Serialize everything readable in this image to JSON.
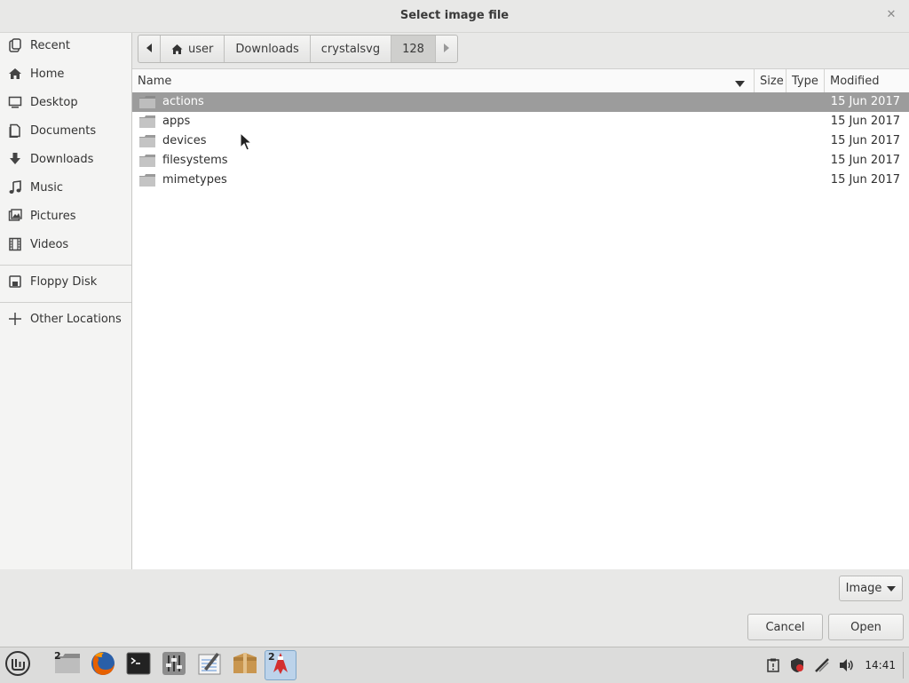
{
  "window": {
    "title": "Select image file"
  },
  "sidebar": {
    "items": [
      {
        "label": "Recent",
        "icon": "recent-icon"
      },
      {
        "label": "Home",
        "icon": "home-icon"
      },
      {
        "label": "Desktop",
        "icon": "desktop-icon"
      },
      {
        "label": "Documents",
        "icon": "documents-icon"
      },
      {
        "label": "Downloads",
        "icon": "downloads-icon"
      },
      {
        "label": "Music",
        "icon": "music-icon"
      },
      {
        "label": "Pictures",
        "icon": "pictures-icon"
      },
      {
        "label": "Videos",
        "icon": "videos-icon"
      },
      {
        "label": "Floppy Disk",
        "icon": "floppy-icon"
      },
      {
        "label": "Other Locations",
        "icon": "plus-icon"
      }
    ]
  },
  "pathbar": {
    "crumbs": [
      "user",
      "Downloads",
      "crystalsvg",
      "128"
    ],
    "active": "128"
  },
  "columns": {
    "name": "Name",
    "size": "Size",
    "type": "Type",
    "modified": "Modified"
  },
  "files": [
    {
      "name": "actions",
      "modified": "15 Jun 2017",
      "selected": true
    },
    {
      "name": "apps",
      "modified": "15 Jun 2017"
    },
    {
      "name": "devices",
      "modified": "15 Jun 2017"
    },
    {
      "name": "filesystems",
      "modified": "15 Jun 2017"
    },
    {
      "name": "mimetypes",
      "modified": "15 Jun 2017"
    }
  ],
  "filter": {
    "label": "Image"
  },
  "buttons": {
    "cancel": "Cancel",
    "open": "Open"
  },
  "taskbar": {
    "file_manager_count": "2",
    "text_editor_count": "2",
    "clock": "14:41"
  },
  "colors": {
    "selection": "#9c9c9c",
    "active_task": "#bcd3ea"
  }
}
